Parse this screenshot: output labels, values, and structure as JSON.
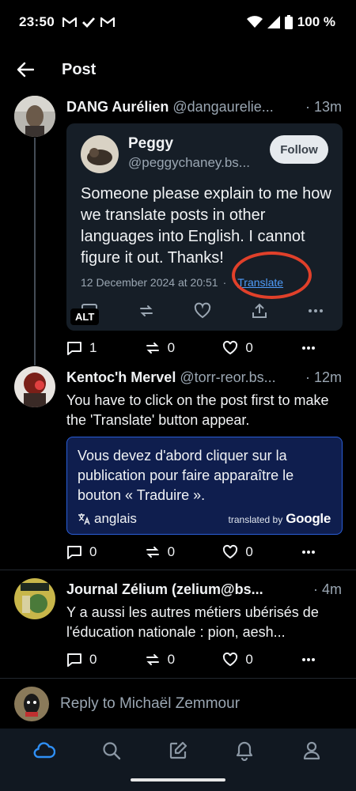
{
  "status_bar": {
    "time": "23:50",
    "battery": "100 %",
    "icons": [
      "gmail-icon",
      "check-icon",
      "gmail-icon",
      "wifi-icon",
      "signal-icon",
      "battery-icon"
    ]
  },
  "header": {
    "title": "Post"
  },
  "posts": [
    {
      "author": "DANG Aurélien",
      "handle": "@dangaurelie...",
      "time": "· 13m",
      "quote": {
        "author": "Peggy",
        "handle": "@peggychaney.bs...",
        "follow_label": "Follow",
        "text": "Someone please explain to me how we translate posts in other languages into English.  I cannot figure it out.  Thanks!",
        "date": "12 December 2024 at 20:51",
        "separator": "·",
        "translate_label": "Translate",
        "alt_badge": "ALT",
        "annotation_color": "#e0402a"
      },
      "replies": "1",
      "reposts": "0",
      "likes": "0"
    },
    {
      "author": "Kentoc'h Mervel",
      "handle": "@torr-reor.bs...",
      "time": "· 12m",
      "text": "You have to click on the post first to make the 'Translate' button appear.",
      "translation": {
        "text": "Vous devez d'abord cliquer sur la publication pour faire apparaître le bouton « Traduire ».",
        "language": "anglais",
        "provider_prefix": "translated by",
        "provider": "Google"
      },
      "replies": "0",
      "reposts": "0",
      "likes": "0"
    },
    {
      "author": "Journal Zélium (zelium@bs...",
      "time": "· 4m",
      "text": "Y a aussi les autres métiers ubérisés de l'éducation nationale : pion, aesh...",
      "replies": "0",
      "reposts": "0",
      "likes": "0"
    }
  ],
  "reply_bar": {
    "placeholder": "Reply to Michaël Zemmour"
  },
  "bottom_nav": {
    "items": [
      "home-icon",
      "search-icon",
      "compose-icon",
      "notifications-icon",
      "profile-icon"
    ],
    "active_color": "#2f8ff5"
  },
  "colors": {
    "background": "#000000",
    "muted_text": "#9aa6b2",
    "link": "#4f9cf9",
    "translation_bg": "#0f1e4e"
  }
}
